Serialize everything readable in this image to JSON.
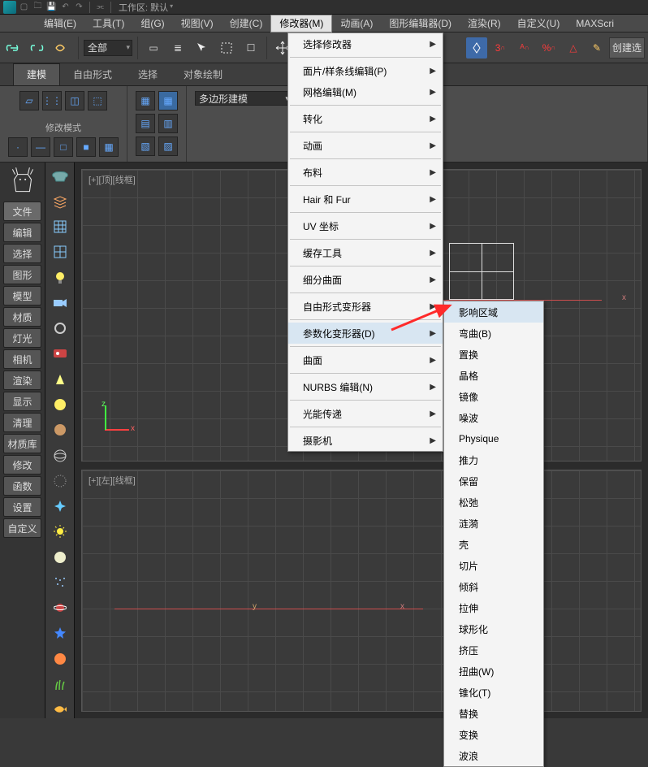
{
  "topbar": {
    "workspace_label": "工作区: 默认"
  },
  "menubar": {
    "edit": "编辑(E)",
    "tools": "工具(T)",
    "group": "组(G)",
    "views": "视图(V)",
    "create": "创建(C)",
    "modifiers": "修改器(M)",
    "animation": "动画(A)",
    "graph": "图形编辑器(D)",
    "render": "渲染(R)",
    "customize": "自定义(U)",
    "maxscript": "MAXScri"
  },
  "toolbar": {
    "selset": "全部",
    "create_panel": "创建选"
  },
  "ribbon": {
    "tabs": {
      "model": "建模",
      "freeform": "自由形式",
      "select": "选择",
      "objpaint": "对象绘制"
    },
    "modify_mode": "修改模式",
    "polybuild": "多边形建模"
  },
  "leftpanel": {
    "items": [
      "文件",
      "编辑",
      "选择",
      "图形",
      "模型",
      "材质",
      "灯光",
      "相机",
      "渲染",
      "显示",
      "清理",
      "材质库",
      "修改",
      "函数",
      "设置",
      "自定义"
    ]
  },
  "viewports": {
    "top": "[+][顶][线框]",
    "left": "[+][左][线框]",
    "axes": {
      "x": "x",
      "y": "y",
      "z": "z"
    }
  },
  "menu_modifiers": {
    "items": [
      {
        "label": "选择修改器",
        "sub": true
      },
      {
        "sep": true
      },
      {
        "label": "面片/样条线编辑(P)",
        "sub": true
      },
      {
        "label": "网格编辑(M)",
        "sub": true
      },
      {
        "sep": true
      },
      {
        "label": "转化",
        "sub": true
      },
      {
        "sep": true
      },
      {
        "label": "动画",
        "sub": true
      },
      {
        "sep": true
      },
      {
        "label": "布料",
        "sub": true
      },
      {
        "sep": true
      },
      {
        "label": "Hair 和 Fur",
        "sub": true
      },
      {
        "sep": true
      },
      {
        "label": "UV 坐标",
        "sub": true
      },
      {
        "sep": true
      },
      {
        "label": "缓存工具",
        "sub": true
      },
      {
        "sep": true
      },
      {
        "label": "细分曲面",
        "sub": true
      },
      {
        "sep": true
      },
      {
        "label": "自由形式变形器",
        "sub": true
      },
      {
        "sep": true
      },
      {
        "label": "参数化变形器(D)",
        "sub": true,
        "hover": true
      },
      {
        "sep": true
      },
      {
        "label": "曲面",
        "sub": true
      },
      {
        "sep": true
      },
      {
        "label": "NURBS 编辑(N)",
        "sub": true
      },
      {
        "sep": true
      },
      {
        "label": "光能传递",
        "sub": true
      },
      {
        "sep": true
      },
      {
        "label": "摄影机",
        "sub": true
      }
    ]
  },
  "menu_param_deformers": {
    "items": [
      {
        "label": "影响区域",
        "hover": true
      },
      {
        "label": "弯曲(B)"
      },
      {
        "label": "置换"
      },
      {
        "label": "晶格"
      },
      {
        "label": "镜像"
      },
      {
        "label": "噪波"
      },
      {
        "label": "Physique"
      },
      {
        "label": "推力"
      },
      {
        "label": "保留"
      },
      {
        "label": "松弛"
      },
      {
        "label": "涟漪"
      },
      {
        "label": "壳"
      },
      {
        "label": "切片"
      },
      {
        "label": "倾斜"
      },
      {
        "label": "拉伸"
      },
      {
        "label": "球形化"
      },
      {
        "label": "挤压"
      },
      {
        "label": "扭曲(W)"
      },
      {
        "label": "锥化(T)"
      },
      {
        "label": "替换"
      },
      {
        "label": "变换"
      },
      {
        "label": "波浪"
      }
    ]
  }
}
